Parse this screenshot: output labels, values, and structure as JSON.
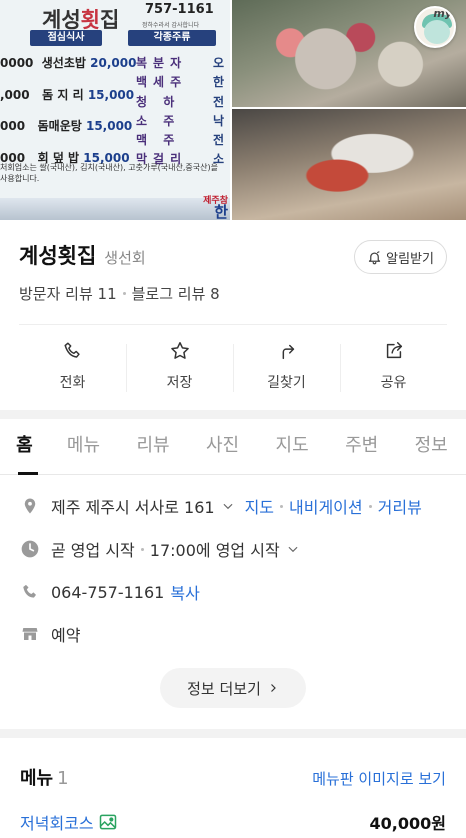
{
  "photos": {
    "board": {
      "title_black": "계성",
      "title_red": "횟",
      "title_black2": "집",
      "phone": "757-1161",
      "phone_sub": "정하수라서 감사합니다",
      "section_lunch": "점심식사",
      "section_drinks": "각종주류",
      "menu_lines": [
        {
          "prefix": "0000",
          "name": "생선초밥",
          "price": "20,000",
          "col2": "복분자",
          "col3": "오"
        },
        {
          "prefix": ",000",
          "name": "돔 지 리",
          "price": "15,000",
          "col2": "백세주",
          "col3": "한"
        },
        {
          "prefix": "000",
          "name": "",
          "price": "",
          "col2": "청 하",
          "col3": "전"
        },
        {
          "prefix": "000",
          "name": "돔매운탕",
          "price": "15,000",
          "col2": "소 주",
          "col3": "낙"
        },
        {
          "prefix": "",
          "name": "",
          "price": "",
          "col2": "맥 주",
          "col3": "전"
        },
        {
          "prefix": "000",
          "name": "회 덮 밥",
          "price": "15,000",
          "col2": "막걸리",
          "col3": "소"
        }
      ],
      "note_line1": "처회업소는 쌀(국내산), 김치(국내산), 고춧가루(국내산,중국산)을",
      "note_line2": "사용합니다.",
      "logo_small": "제주참",
      "logo_big": "한"
    },
    "badge_text": "my"
  },
  "place": {
    "name": "계성횟집",
    "category": "생선회",
    "alarm_label": "알림받기",
    "visitor_reviews": "방문자 리뷰 11",
    "blog_reviews": "블로그 리뷰 8"
  },
  "actions": [
    {
      "label": "전화",
      "icon": "phone-icon"
    },
    {
      "label": "저장",
      "icon": "star-icon"
    },
    {
      "label": "길찾기",
      "icon": "directions-icon"
    },
    {
      "label": "공유",
      "icon": "share-icon"
    }
  ],
  "tabs": [
    "홈",
    "메뉴",
    "리뷰",
    "사진",
    "지도",
    "주변",
    "정보"
  ],
  "details": {
    "address": "제주 제주시 서사로 161",
    "map_link": "지도",
    "navi_link": "내비게이션",
    "street_link": "거리뷰",
    "status": "곧 영업 시작",
    "open_time": "17:00에 영업 시작",
    "phone": "064-757-1161",
    "copy_link": "복사",
    "reservation": "예약",
    "more_label": "정보 더보기"
  },
  "menu": {
    "title": "메뉴",
    "count": "1",
    "image_link": "메뉴판 이미지로 보기",
    "items": [
      {
        "name": "저녁회코스",
        "price": "40,000원"
      }
    ]
  },
  "colors": {
    "link": "#2970d8",
    "board_blue": "#26417d",
    "board_red": "#c73340"
  }
}
